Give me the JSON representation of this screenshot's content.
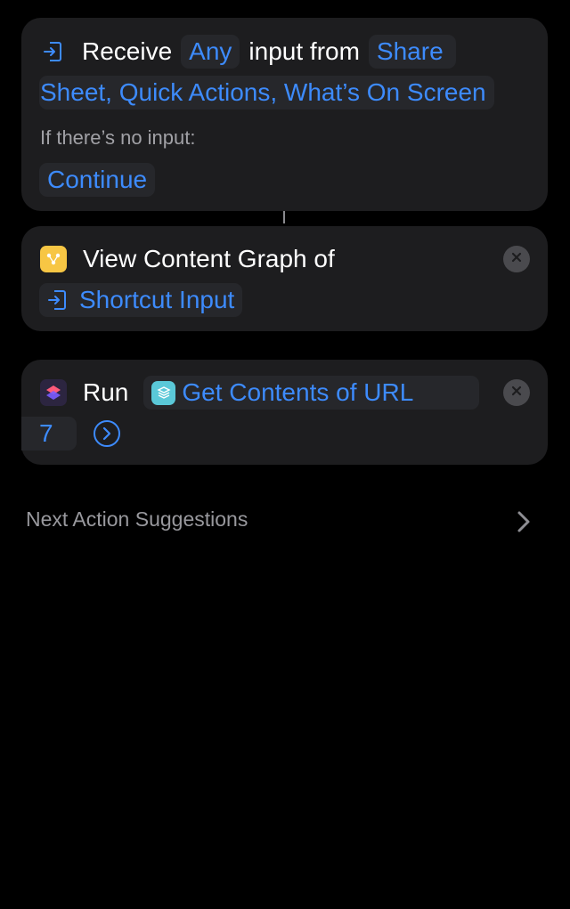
{
  "receive_action": {
    "receive_label": "Receive",
    "input_type": "Any",
    "input_from_label": "input from",
    "source_part1": "Share",
    "source_part2": "Sheet, Quick Actions, What’s On Screen",
    "no_input_label": "If there’s no input:",
    "no_input_behavior": "Continue",
    "icon": "input-arrow-icon"
  },
  "content_graph_action": {
    "label": "View Content Graph of",
    "variable": "Shortcut Input",
    "icon": "content-graph-icon",
    "variable_icon": "input-arrow-icon",
    "accent_color": "#f7c644"
  },
  "run_action": {
    "run_label": "Run",
    "shortcut_name": "Get Contents of URL",
    "shortcut_name_continued": "7",
    "icon": "shortcuts-app-icon",
    "shortcut_icon": "layers-icon",
    "shortcut_icon_color": "#5ac8d8"
  },
  "next_suggestions": {
    "label": "Next Action Suggestions"
  },
  "colors": {
    "background": "#000000",
    "card": "#1d1d1f",
    "token_text": "#3d8bfd",
    "token_bg": "#26272b"
  }
}
